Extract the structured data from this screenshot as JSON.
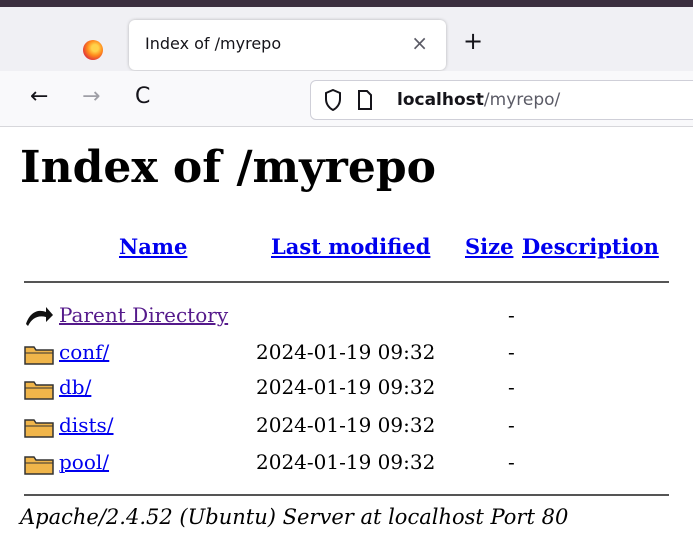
{
  "browser": {
    "tab": {
      "title": "Index of /myrepo",
      "close_glyph": "×",
      "icon": "firefox-icon"
    },
    "new_tab_glyph": "+",
    "nav": {
      "back_glyph": "←",
      "forward_glyph": "→",
      "reload_glyph": "C"
    },
    "url": {
      "host": "localhost",
      "path": "/myrepo/"
    }
  },
  "page": {
    "title": "Index of /myrepo",
    "columns": {
      "name": "Name",
      "last_modified": "Last modified",
      "size": "Size",
      "description": "Description"
    },
    "entries": [
      {
        "name": "Parent Directory",
        "modified": "",
        "size": "-",
        "icon": "back-arrow-icon",
        "visited": true
      },
      {
        "name": "conf/",
        "modified": "2024-01-19 09:32",
        "size": "-",
        "icon": "folder-icon",
        "visited": false
      },
      {
        "name": "db/",
        "modified": "2024-01-19 09:32",
        "size": "-",
        "icon": "folder-icon",
        "visited": false
      },
      {
        "name": "dists/",
        "modified": "2024-01-19 09:32",
        "size": "-",
        "icon": "folder-icon",
        "visited": false
      },
      {
        "name": "pool/",
        "modified": "2024-01-19 09:32",
        "size": "-",
        "icon": "folder-icon",
        "visited": false
      }
    ],
    "footer": "Apache/2.4.52 (Ubuntu) Server at localhost Port 80"
  },
  "colors": {
    "link": "#0000ee",
    "visited_link": "#551a8b",
    "folder": "#f0b54a"
  }
}
